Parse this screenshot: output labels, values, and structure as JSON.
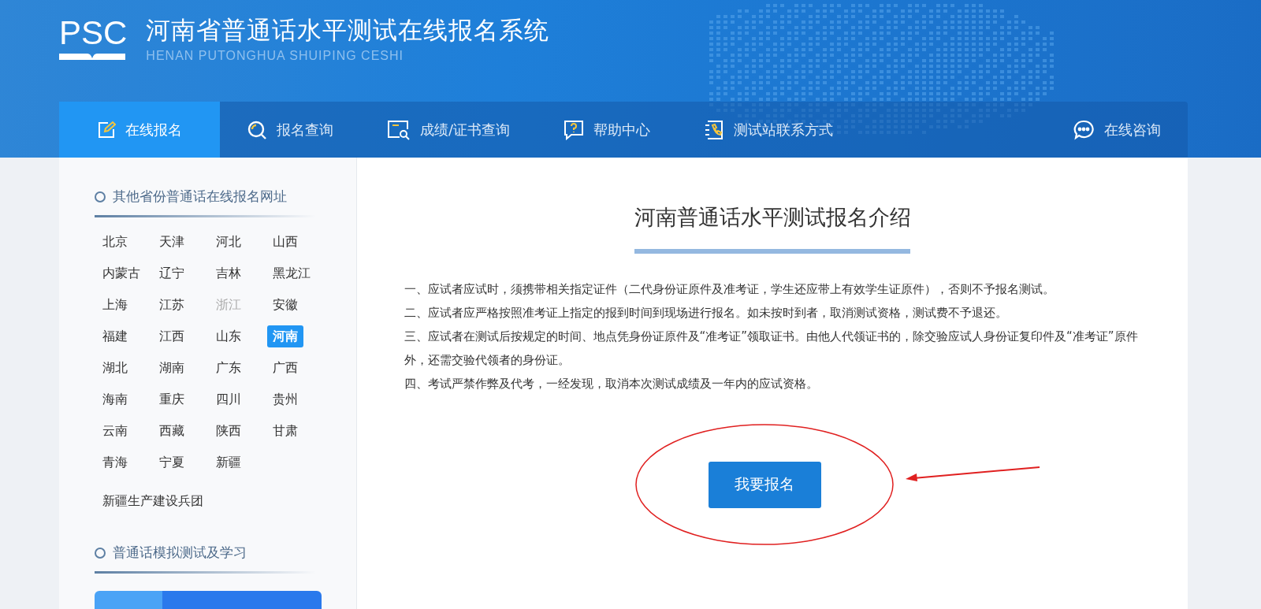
{
  "header": {
    "logo": "PSC",
    "title": "河南省普通话水平测试在线报名系统",
    "subtitle": "HENAN PUTONGHUA SHUIPING CESHI"
  },
  "nav": {
    "tabs": [
      {
        "label": "在线报名",
        "kind": "edit",
        "selected": true
      },
      {
        "label": "报名查询",
        "kind": "search",
        "selected": false
      },
      {
        "label": "成绩/证书查询",
        "kind": "certificate",
        "selected": false
      },
      {
        "label": "帮助中心",
        "kind": "help",
        "selected": false
      },
      {
        "label": "测试站联系方式",
        "kind": "phone",
        "selected": false
      }
    ],
    "consult": {
      "label": "在线咨询"
    }
  },
  "sidebar": {
    "provinces_heading": "其他省份普通话在线报名网址",
    "provinces": [
      {
        "name": "北京",
        "selected": false,
        "disabled": false
      },
      {
        "name": "天津",
        "selected": false,
        "disabled": false
      },
      {
        "name": "河北",
        "selected": false,
        "disabled": false
      },
      {
        "name": "山西",
        "selected": false,
        "disabled": false
      },
      {
        "name": "内蒙古",
        "selected": false,
        "disabled": false
      },
      {
        "name": "辽宁",
        "selected": false,
        "disabled": false
      },
      {
        "name": "吉林",
        "selected": false,
        "disabled": false
      },
      {
        "name": "黑龙江",
        "selected": false,
        "disabled": false
      },
      {
        "name": "上海",
        "selected": false,
        "disabled": false
      },
      {
        "name": "江苏",
        "selected": false,
        "disabled": false
      },
      {
        "name": "浙江",
        "selected": false,
        "disabled": true
      },
      {
        "name": "安徽",
        "selected": false,
        "disabled": false
      },
      {
        "name": "福建",
        "selected": false,
        "disabled": false
      },
      {
        "name": "江西",
        "selected": false,
        "disabled": false
      },
      {
        "name": "山东",
        "selected": false,
        "disabled": false
      },
      {
        "name": "河南",
        "selected": true,
        "disabled": false
      },
      {
        "name": "湖北",
        "selected": false,
        "disabled": false
      },
      {
        "name": "湖南",
        "selected": false,
        "disabled": false
      },
      {
        "name": "广东",
        "selected": false,
        "disabled": false
      },
      {
        "name": "广西",
        "selected": false,
        "disabled": false
      },
      {
        "name": "海南",
        "selected": false,
        "disabled": false
      },
      {
        "name": "重庆",
        "selected": false,
        "disabled": false
      },
      {
        "name": "四川",
        "selected": false,
        "disabled": false
      },
      {
        "name": "贵州",
        "selected": false,
        "disabled": false
      },
      {
        "name": "云南",
        "selected": false,
        "disabled": false
      },
      {
        "name": "西藏",
        "selected": false,
        "disabled": false
      },
      {
        "name": "陕西",
        "selected": false,
        "disabled": false
      },
      {
        "name": "甘肃",
        "selected": false,
        "disabled": false
      },
      {
        "name": "青海",
        "selected": false,
        "disabled": false
      },
      {
        "name": "宁夏",
        "selected": false,
        "disabled": false
      },
      {
        "name": "新疆",
        "selected": false,
        "disabled": false
      }
    ],
    "extra_link": "新疆生产建设兵团",
    "practice_heading": "普通话模拟测试及学习"
  },
  "main": {
    "title": "河南普通话水平测试报名介绍",
    "rules": [
      "一、应试者应试时，须携带相关指定证件（二代身份证原件及准考证，学生还应带上有效学生证原件），否则不予报名测试。",
      "二、应试者应严格按照准考证上指定的报到时间到现场进行报名。如未按时到者，取消测试资格，测试费不予退还。",
      "三、应试者在测试后按规定的时间、地点凭身份证原件及“准考证”领取证书。由他人代领证书的，除交验应试人身份证复印件及“准考证”原件外，还需交验代领者的身份证。",
      "四、考试严禁作弊及代考，一经发现，取消本次测试成绩及一年内的应试资格。"
    ],
    "register_button": "我要报名"
  }
}
